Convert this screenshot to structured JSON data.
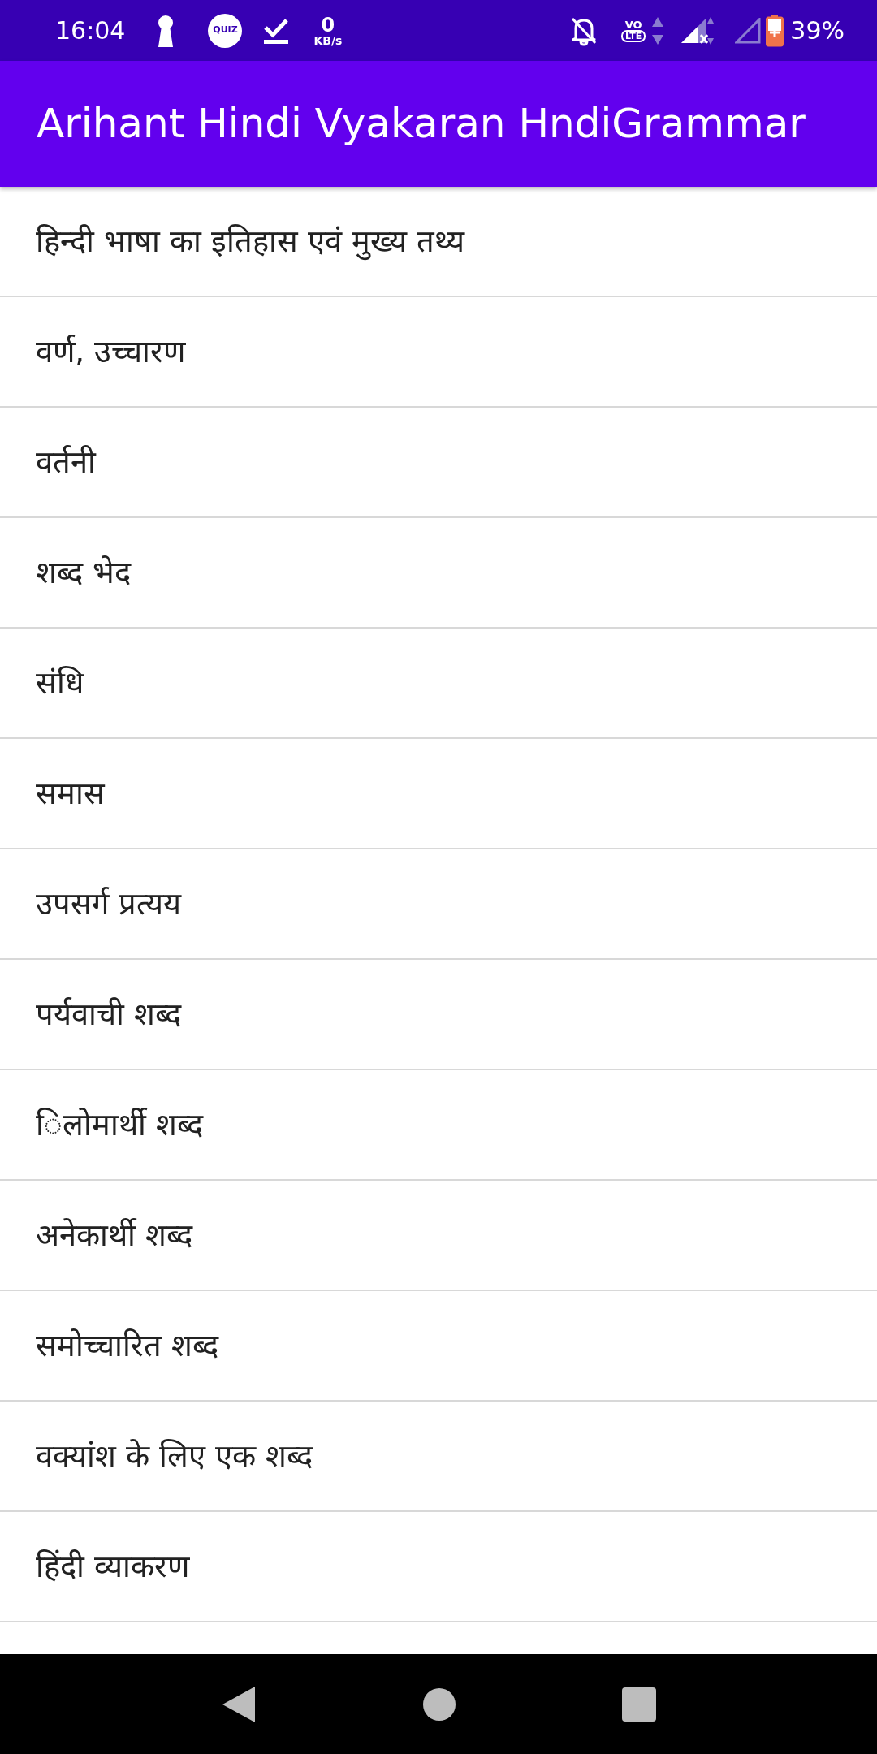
{
  "status_bar": {
    "time": "16:04",
    "quiz_label": "QUIZ",
    "speed_value": "0",
    "speed_unit": "KB/s",
    "volte_top": "VO",
    "volte_bottom": "LTE",
    "battery": "39%"
  },
  "app_bar": {
    "title": "Arihant Hindi Vyakaran HndiGrammar"
  },
  "items": [
    {
      "label": "हिन्दी भाषा का इतिहास एवं मुख्य तथ्य"
    },
    {
      "label": "वर्ण, उच्चारण"
    },
    {
      "label": "वर्तनी"
    },
    {
      "label": "शब्द भेद"
    },
    {
      "label": "संधि"
    },
    {
      "label": "समास"
    },
    {
      "label": "उपसर्ग प्रत्यय"
    },
    {
      "label": "पर्यवाची शब्द"
    },
    {
      "label": "िलोमार्थी शब्द"
    },
    {
      "label": "अनेकार्थी शब्द"
    },
    {
      "label": "समोच्चारित शब्द"
    },
    {
      "label": "वक्यांश के लिए एक शब्द"
    },
    {
      "label": "हिंदी व्याकरण"
    }
  ]
}
